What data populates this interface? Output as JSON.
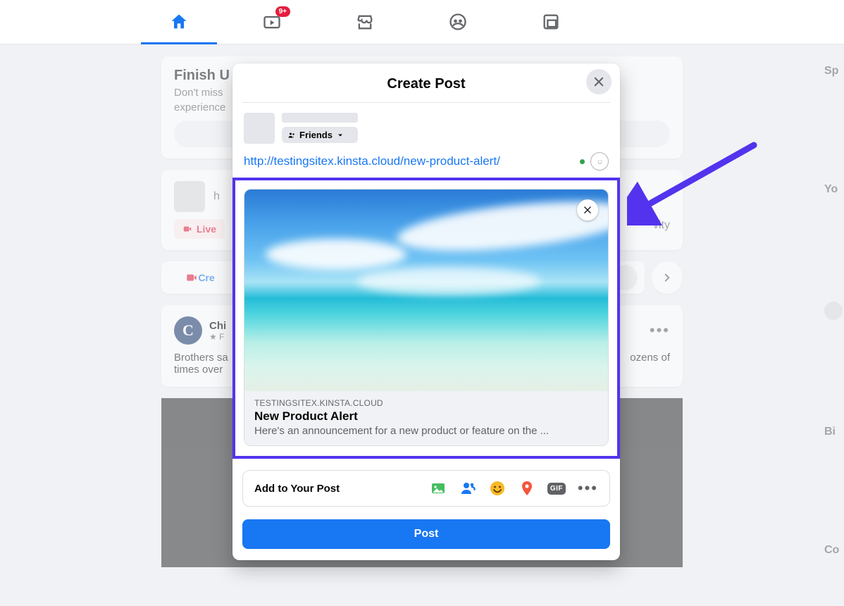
{
  "nav": {
    "watch_badge": "9+"
  },
  "feed": {
    "finish_title": "Finish U",
    "finish_sub1": "Don't miss",
    "finish_sub2": "experience",
    "live_label": "Live",
    "activity_text": "vity",
    "create_label": "Cre",
    "post_author_initial": "C",
    "post_author_name": "Chi",
    "post_author_meta": "★ F",
    "post_body1": "Brothers sa",
    "post_body2": "times over",
    "post_body_right": "ozens of"
  },
  "right": {
    "sponsored": "Sp",
    "your": "Yo",
    "birthdays": "Bi",
    "contacts": "Co"
  },
  "modal": {
    "title": "Create Post",
    "audience_label": "Friends",
    "url_text": "http://testingsitex.kinsta.cloud/new-product-alert/",
    "preview": {
      "domain": "TESTINGSITEX.KINSTA.CLOUD",
      "title": "New Product Alert",
      "description": "Here's an announcement for a new product or feature on the ..."
    },
    "add_label": "Add to Your Post",
    "gif_label": "GIF",
    "post_button": "Post"
  }
}
